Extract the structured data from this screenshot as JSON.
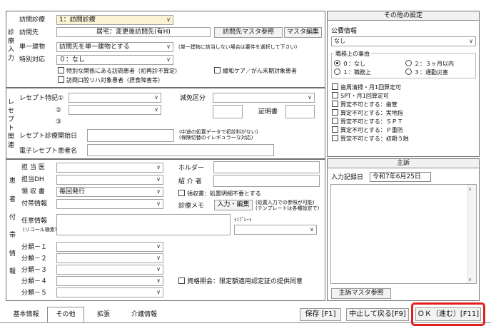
{
  "visit": {
    "section_label": [
      "診",
      "療",
      "入",
      "力"
    ],
    "visit_type_label": "訪問診療",
    "visit_type_value": "1：訪問診療",
    "visit_place_label": "訪問先",
    "visit_place_value": "居宅：変更後訪問先(有H)",
    "place_master_button": "訪問先マスタ参照",
    "master_edit_button": "マスタ編集",
    "building_label": "単一建物",
    "building_value": "訪問先を単一建物とする",
    "building_note": "(単一建物に該当しない場合は要件を選択して下さい)",
    "special_label": "特別対応",
    "special_value": "０：なし",
    "cb_special_patient": "特別な関係にある訪問患者（初再診不算定）",
    "cb_palliative": "緩和ケア／がん末期対象患者",
    "cb_oral": "訪問口腔リハ対象患者（摂食障害等）"
  },
  "receipt": {
    "section_label": [
      "レ",
      "セ",
      "プ",
      "ト",
      "関",
      "連"
    ],
    "special_label": "レセプト特記①",
    "special_2": "②",
    "special_3": "③",
    "reduction_label": "減免区分",
    "certificate_label": "証明書",
    "start_label": "レセプト診療開始日",
    "start_note_1": "(中途の処置データで初診料がない)",
    "start_note_2": "(保険切替のイレギュラーな対応)",
    "e_receipt_label": "電子レセプト患者名"
  },
  "patient": {
    "section_label": [
      "患",
      "者",
      "付",
      "帯",
      "情",
      "報"
    ],
    "doctor_label": "担 当 医",
    "dh_label": "担当DH",
    "receipt_doc_label": "領 収 書",
    "receipt_doc_value": "毎回発行",
    "attach_label": "付帯情報",
    "holder_label": "ホルダー",
    "referrer_label": "紹 介 者",
    "cb_receipt_detail": "領収書：処置明細不要とする",
    "memo_label": "診療メモ",
    "input_edit_button": "入力・編集",
    "memo_note_1": "(処置入力での参照が可能)",
    "memo_note_2": "(テンプレートは各種設定で)",
    "optional_label": "任意情報",
    "optional_sub": "(リコール検索可)",
    "template_label": "ﾃﾝﾌﾟﾚｰﾄ",
    "classes": [
      "分類－１",
      "分類－２",
      "分類－３",
      "分類－４",
      "分類－５"
    ],
    "cb_qualification": "資格照会：限定額適用認定証の提供同意"
  },
  "other_settings": {
    "title": "その他の設定",
    "public_label": "公費情報",
    "public_value": "なし",
    "duty_label": "職務上の事由",
    "radios": [
      "０：なし",
      "２：３ヶ月以内",
      "１：職務上",
      "３：通勤災害"
    ],
    "checks": [
      "歯周清掃・月1回算定可",
      "SPT・月1回算定可",
      "算定不可とする：歯管",
      "算定不可とする：実地指",
      "算定不可とする：ＳＰＴ",
      "算定不可とする：Ｐ重防",
      "算定不可とする：初期う蝕"
    ]
  },
  "complaint": {
    "title": "主訴",
    "record_label": "入力記録日",
    "record_date": "令和7年6月25日",
    "master_button": "主訴マスタ参照"
  },
  "tabs": [
    "基本情報",
    "その他",
    "拡張",
    "介護情報"
  ],
  "footer": {
    "save_button": "保存 [F1]",
    "cancel_button": "中止して戻る[F9]",
    "ok_button": "ＯＫ（進む）[F11]"
  },
  "colors": {
    "highlight_border": "#e02020",
    "select_highlight": "#fbf3d3"
  }
}
